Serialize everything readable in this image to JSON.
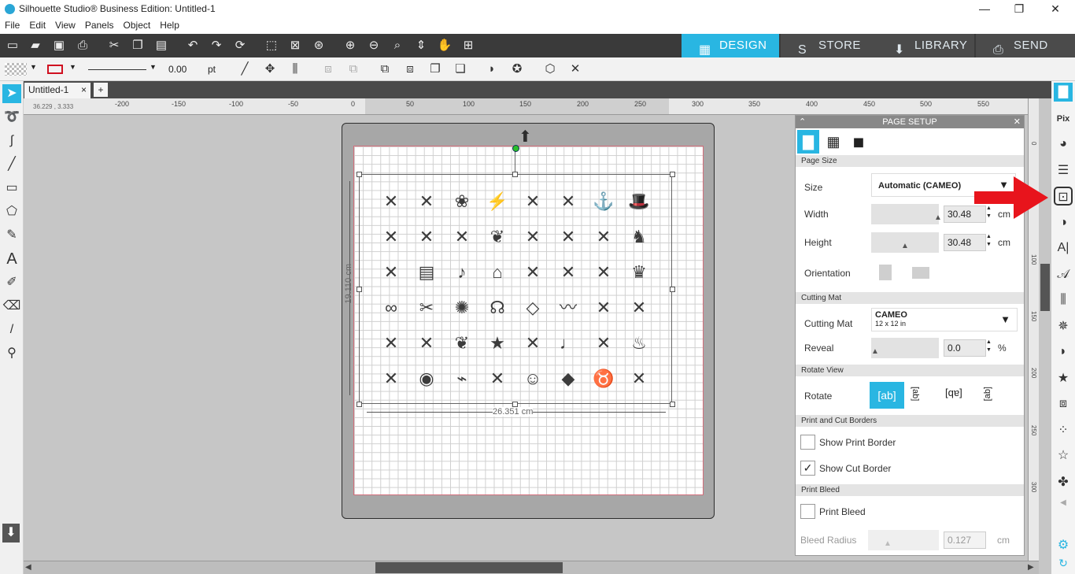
{
  "app": {
    "title": "Silhouette Studio® Business Edition: Untitled-1",
    "min": "—",
    "max": "❐",
    "close": "✕"
  },
  "menu": [
    "File",
    "Edit",
    "View",
    "Panels",
    "Object",
    "Help"
  ],
  "nav_tabs": [
    {
      "label": "DESIGN",
      "icon": "▦"
    },
    {
      "label": "STORE",
      "icon": "S"
    },
    {
      "label": "LIBRARY",
      "icon": "⬇"
    },
    {
      "label": "SEND",
      "icon": "⎙"
    }
  ],
  "toolbar": {
    "line_width": "0.00",
    "line_unit": "pt"
  },
  "doc_tab": {
    "label": "Untitled-1",
    "close": "×",
    "add": "+"
  },
  "ruler": {
    "cursor": "36.229 , 3.333",
    "labels": [
      "-200",
      "-150",
      "-100",
      "-50",
      "0",
      "50",
      "100",
      "150",
      "200",
      "250",
      "300",
      "350",
      "400",
      "450",
      "500",
      "550"
    ]
  },
  "vruler": [
    "0",
    "50",
    "100",
    "150",
    "200",
    "250",
    "300"
  ],
  "canvas": {
    "height_dim": "19.110 cm",
    "width_dim": "26.351 cm"
  },
  "panel": {
    "title": "PAGE SETUP",
    "page_size_section": "Page Size",
    "size_label": "Size",
    "size_value": "Automatic (CAMEO)",
    "width_label": "Width",
    "width_value": "30.48",
    "width_unit": "cm",
    "height_label": "Height",
    "height_value": "30.48",
    "height_unit": "cm",
    "orientation_label": "Orientation",
    "cutting_mat_section": "Cutting Mat",
    "mat_label": "Cutting Mat",
    "mat_value": "CAMEO",
    "mat_sub": "12 x 12 in",
    "reveal_label": "Reveal",
    "reveal_value": "0.0",
    "reveal_unit": "%",
    "rotate_section": "Rotate View",
    "rotate_label": "Rotate",
    "borders_section": "Print and Cut Borders",
    "show_print_border": "Show Print Border",
    "show_cut_border": "Show Cut Border",
    "bleed_section": "Print Bleed",
    "print_bleed": "Print Bleed",
    "bleed_radius_label": "Bleed Radius",
    "bleed_radius_value": "0.127",
    "bleed_radius_unit": "cm"
  },
  "glyph_rows": [
    [
      "✕",
      "✕",
      "❀",
      "⚡",
      "✕",
      "✕",
      "⚓",
      "🎩"
    ],
    [
      "✕",
      "✕",
      "✕",
      "❦",
      "✕",
      "✕",
      "✕",
      "♞"
    ],
    [
      "✕",
      "▤",
      "♪",
      "⌂",
      "✕",
      "✕",
      "✕",
      "♛"
    ],
    [
      "∞",
      "✂",
      "✺",
      "☊",
      "◇",
      "〰",
      "✕",
      "✕"
    ],
    [
      "✕",
      "✕",
      "❦",
      "★",
      "✕",
      "♩",
      "✕",
      "♨"
    ],
    [
      "✕",
      "◉",
      "⌁",
      "✕",
      "☺",
      "◆",
      "♉",
      "✕"
    ]
  ],
  "colors": {
    "accent": "#29b6e2",
    "arrow": "#e8141c"
  }
}
